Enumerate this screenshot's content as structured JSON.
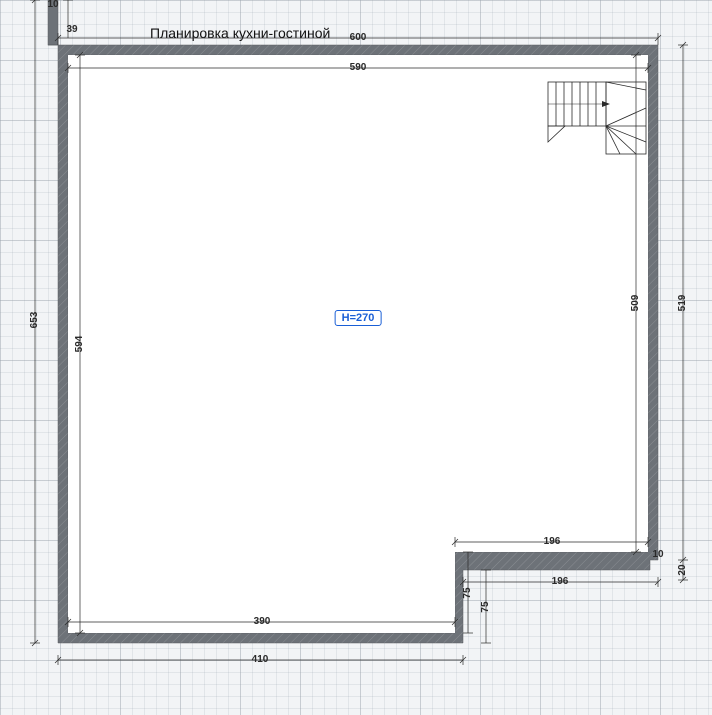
{
  "title": "Планировка кухни-гостиной",
  "ceiling_label": "H=270",
  "dimensions": {
    "top_outer_right": "600",
    "top_outer_left_stub": "10",
    "top_outer_left_stub_v": "39",
    "top_inner": "590",
    "left_outer": "653",
    "left_inner": "594",
    "right_outer": "519",
    "right_inner": "509",
    "notch_right_outer_v": "20",
    "notch_right_inner_v": "10",
    "notch_right_inner_h": "196",
    "notch_right_outer_h": "196",
    "notch_step_inner_v": "75",
    "notch_step_outer_v": "75",
    "bottom_inner": "390",
    "bottom_outer": "410"
  }
}
